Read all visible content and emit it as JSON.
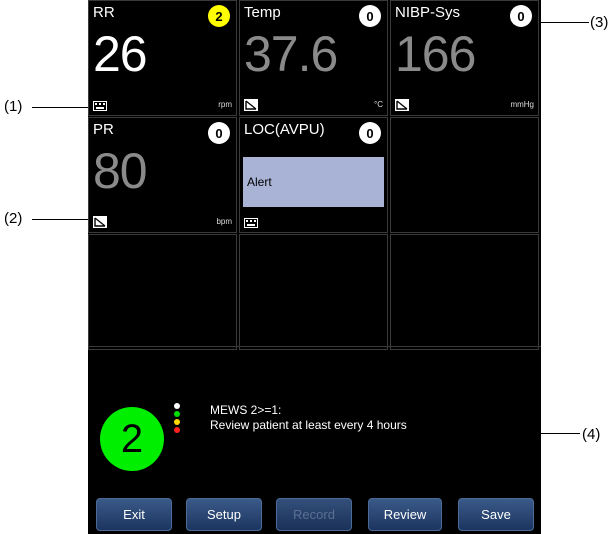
{
  "callouts": [
    "(1)",
    "(2)",
    "(3)",
    "(4)"
  ],
  "tiles": [
    {
      "name": "RR",
      "score": "2",
      "value": "26",
      "unit": "rpm",
      "source": "keyboard-icon"
    },
    {
      "name": "Temp",
      "score": "0",
      "value": "37.6",
      "unit": "°C",
      "source": "manual-input-icon"
    },
    {
      "name": "NIBP-Sys",
      "score": "0",
      "value": "166",
      "unit": "mmHg",
      "source": "manual-input-icon"
    },
    {
      "name": "PR",
      "score": "0",
      "value": "80",
      "unit": "bpm",
      "source": "manual-input-icon"
    },
    {
      "name": "LOC(AVPU)",
      "score": "0",
      "value": "Alert",
      "unit": "",
      "source": "keyboard-icon"
    }
  ],
  "mews": {
    "total_score": "2",
    "message_title": "MEWS 2>=1:",
    "message_text": "Review patient at least every 4 hours"
  },
  "buttons": {
    "exit": "Exit",
    "setup": "Setup",
    "record": "Record",
    "review": "Review",
    "save": "Save"
  },
  "colors": {
    "score_highlight": "#ffff00",
    "total_score_bg": "#00ee00",
    "avpu_box": "#a9b3d6",
    "button": "#2a4a78"
  }
}
